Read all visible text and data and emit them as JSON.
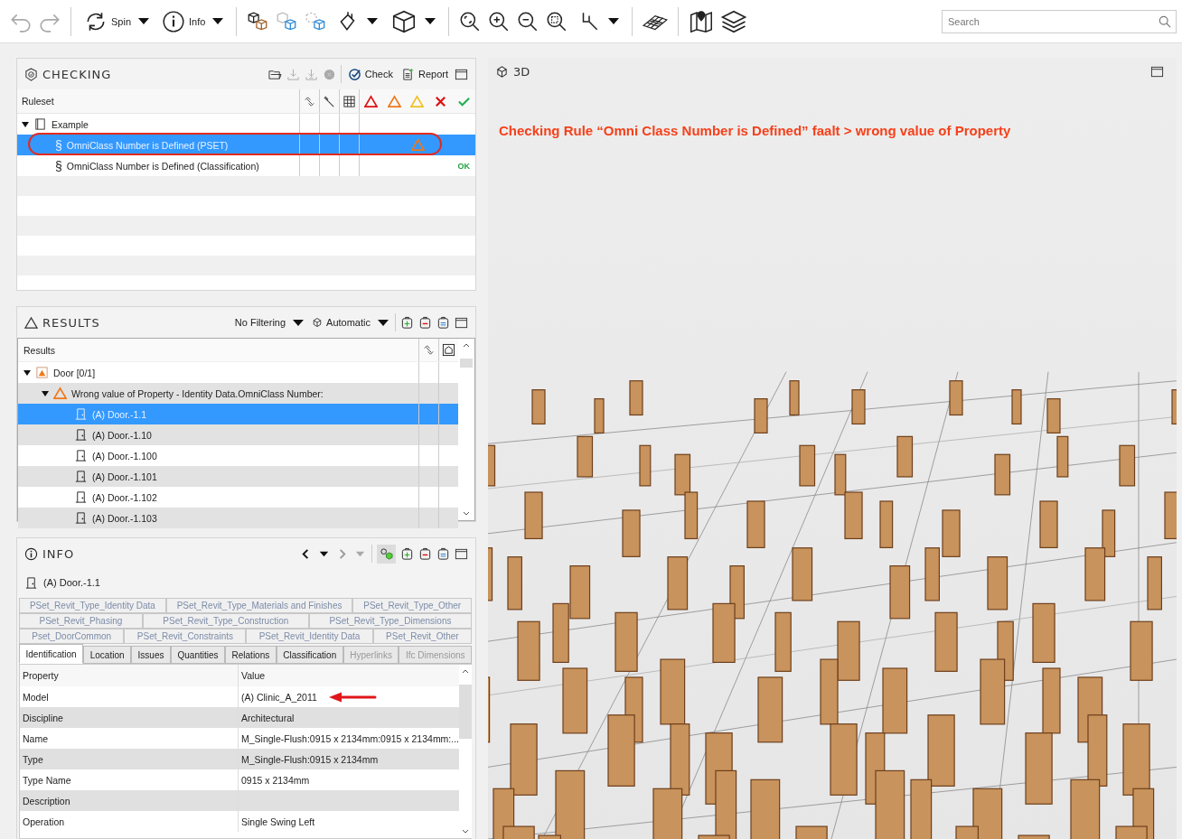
{
  "toolbar": {
    "undo": {
      "disabled": true
    },
    "redo": {
      "disabled": true
    },
    "spin_label": "Spin",
    "info_label": "Info",
    "search": {
      "placeholder": "Search"
    }
  },
  "checking": {
    "title": "CHECKING",
    "actions": [
      {
        "label": "Check"
      },
      {
        "label": "Report"
      }
    ],
    "column": "Ruleset",
    "tree": [
      {
        "label": "Example",
        "expanded": true,
        "children": [
          {
            "symbol": "§",
            "label": "OmniClass Number is Defined (PSET)",
            "selected": true,
            "circled": true,
            "kind": "warning"
          },
          {
            "symbol": "§",
            "label": "OmniClass Number is Defined (Classification)",
            "selected": false,
            "circled": false,
            "kind": "ok",
            "status_label": "OK"
          }
        ]
      }
    ]
  },
  "results": {
    "title": "RESULTS",
    "filter": "No Filtering",
    "mode": "Automatic",
    "column": "Results",
    "tree": [
      {
        "label": "Door [0/1]",
        "expanded": true,
        "children": [
          {
            "label": "Wrong value of Property - Identity Data.OmniClass Number:",
            "expanded": true,
            "children": [
              {
                "label": "(A) Door.-1.1",
                "selected": true
              },
              {
                "label": "(A) Door.-1.10",
                "selected": false
              },
              {
                "label": "(A) Door.-1.100",
                "selected": false
              },
              {
                "label": "(A) Door.-1.101",
                "selected": false
              },
              {
                "label": "(A) Door.-1.102",
                "selected": false
              },
              {
                "label": "(A) Door.-1.103",
                "selected": false
              }
            ]
          }
        ]
      }
    ]
  },
  "info": {
    "title": "INFO",
    "element": "(A) Door.-1.1",
    "pset_tab_rows": [
      [
        "PSet_Revit_Type_Identity Data",
        "PSet_Revit_Type_Materials and Finishes",
        "PSet_Revit_Type_Other"
      ],
      [
        "PSet_Revit_Phasing",
        "PSet_Revit_Type_Construction",
        "PSet_Revit_Type_Dimensions"
      ],
      [
        "Pset_DoorCommon",
        "PSet_Revit_Constraints",
        "PSet_Revit_Identity Data",
        "PSet_Revit_Other"
      ]
    ],
    "tabs": [
      {
        "label": "Identification",
        "selected": true,
        "disabled": false
      },
      {
        "label": "Location",
        "selected": false,
        "disabled": false
      },
      {
        "label": "Issues",
        "selected": false,
        "disabled": false
      },
      {
        "label": "Quantities",
        "selected": false,
        "disabled": false
      },
      {
        "label": "Relations",
        "selected": false,
        "disabled": false
      },
      {
        "label": "Classification",
        "selected": false,
        "disabled": false
      },
      {
        "label": "Hyperlinks",
        "selected": false,
        "disabled": true
      },
      {
        "label": "Ifc Dimensions",
        "selected": false,
        "disabled": true
      }
    ],
    "columns": [
      "Property",
      "Value"
    ],
    "rows": [
      {
        "property": "Model",
        "value": "(A) Clinic_A_2011",
        "arrow": true
      },
      {
        "property": "Discipline",
        "value": "Architectural",
        "arrow": false
      },
      {
        "property": "Name",
        "value": "M_Single-Flush:0915 x 2134mm:0915 x 2134mm:...",
        "arrow": false
      },
      {
        "property": "Type",
        "value": "M_Single-Flush:0915 x 2134mm",
        "arrow": false
      },
      {
        "property": "Type Name",
        "value": "0915 x 2134mm",
        "arrow": false
      },
      {
        "property": "Description",
        "value": "",
        "arrow": false
      },
      {
        "property": "Operation",
        "value": "Single Swing Left",
        "arrow": false
      }
    ]
  },
  "view": {
    "title": "3D",
    "annotation": "Checking Rule “Omni Class Number is Defined”  faalt > wrong value of Property"
  }
}
